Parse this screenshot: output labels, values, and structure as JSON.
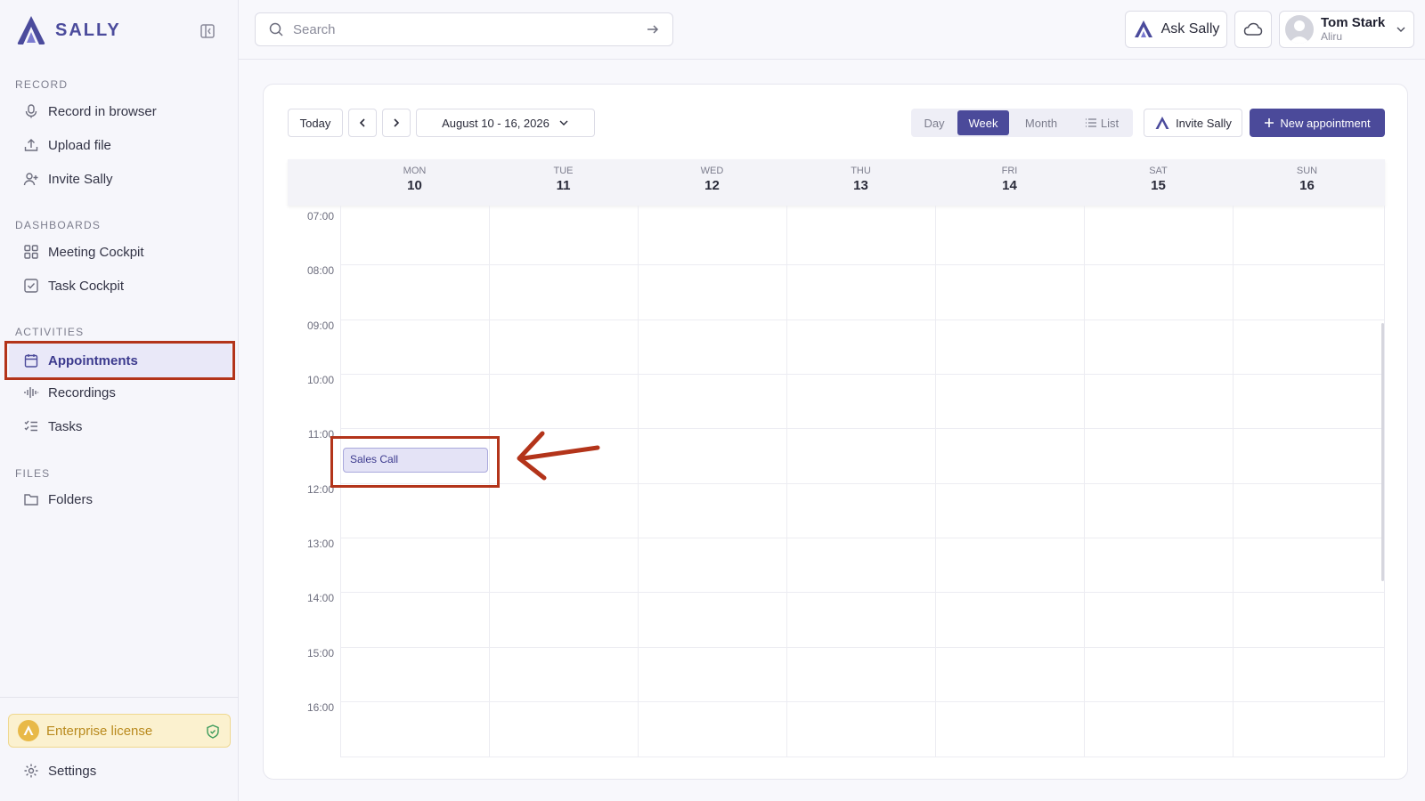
{
  "app": {
    "name": "SALLY"
  },
  "sidebar": {
    "sections": [
      {
        "title": "RECORD",
        "items": [
          {
            "label": "Record in browser",
            "icon": "microphone-icon"
          },
          {
            "label": "Upload file",
            "icon": "upload-icon"
          },
          {
            "label": "Invite Sally",
            "icon": "user-plus-icon"
          }
        ]
      },
      {
        "title": "DASHBOARDS",
        "items": [
          {
            "label": "Meeting Cockpit",
            "icon": "grid-icon"
          },
          {
            "label": "Task Cockpit",
            "icon": "checkbox-icon"
          }
        ]
      },
      {
        "title": "ACTIVITIES",
        "items": [
          {
            "label": "Appointments",
            "icon": "calendar-icon",
            "active": true
          },
          {
            "label": "Recordings",
            "icon": "waveform-icon"
          },
          {
            "label": "Tasks",
            "icon": "checklist-icon"
          }
        ]
      },
      {
        "title": "FILES",
        "items": [
          {
            "label": "Folders",
            "icon": "folder-icon"
          }
        ]
      }
    ],
    "license_label": "Enterprise license",
    "settings_label": "Settings"
  },
  "topbar": {
    "search_placeholder": "Search",
    "ask_label": "Ask Sally",
    "user": {
      "name": "Tom Stark",
      "org": "Aliru"
    }
  },
  "toolbar": {
    "today_label": "Today",
    "date_range": "August 10 - 16, 2026",
    "views": [
      "Day",
      "Week",
      "Month",
      "List"
    ],
    "active_view": "Week",
    "invite_label": "Invite Sally",
    "new_appointment_label": "New appointment"
  },
  "calendar": {
    "days": [
      {
        "name": "MON",
        "num": "10"
      },
      {
        "name": "TUE",
        "num": "11"
      },
      {
        "name": "WED",
        "num": "12"
      },
      {
        "name": "THU",
        "num": "13"
      },
      {
        "name": "FRI",
        "num": "14"
      },
      {
        "name": "SAT",
        "num": "15"
      },
      {
        "name": "SUN",
        "num": "16"
      }
    ],
    "hours": [
      "07:00",
      "08:00",
      "09:00",
      "10:00",
      "11:00",
      "12:00",
      "13:00",
      "14:00",
      "15:00",
      "16:00"
    ],
    "events": [
      {
        "title": "Sales Call",
        "day": "MON",
        "start": "11:30"
      }
    ]
  },
  "colors": {
    "brand": "#4b4a9a",
    "highlight": "#b3341a",
    "license": "#fbf1cf"
  }
}
